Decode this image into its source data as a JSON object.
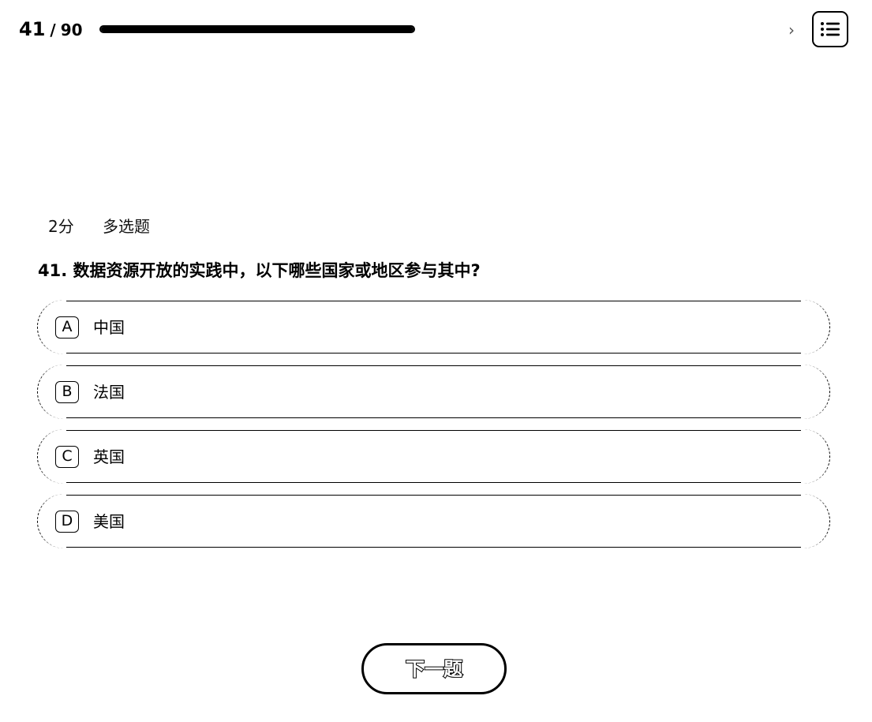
{
  "progress": {
    "current": "41",
    "separator": "/",
    "total": "90",
    "fraction": 1.0
  },
  "header": {
    "next_icon": "chevron-right-icon",
    "menu_icon": "list-icon"
  },
  "question": {
    "score": "2分",
    "type": "多选题",
    "text": "41. 数据资源开放的实践中，以下哪些国家或地区参与其中?"
  },
  "options": [
    {
      "letter": "A",
      "label": "中国"
    },
    {
      "letter": "B",
      "label": "法国"
    },
    {
      "letter": "C",
      "label": "英国"
    },
    {
      "letter": "D",
      "label": "美国"
    }
  ],
  "footer": {
    "next_label": "下一题"
  }
}
